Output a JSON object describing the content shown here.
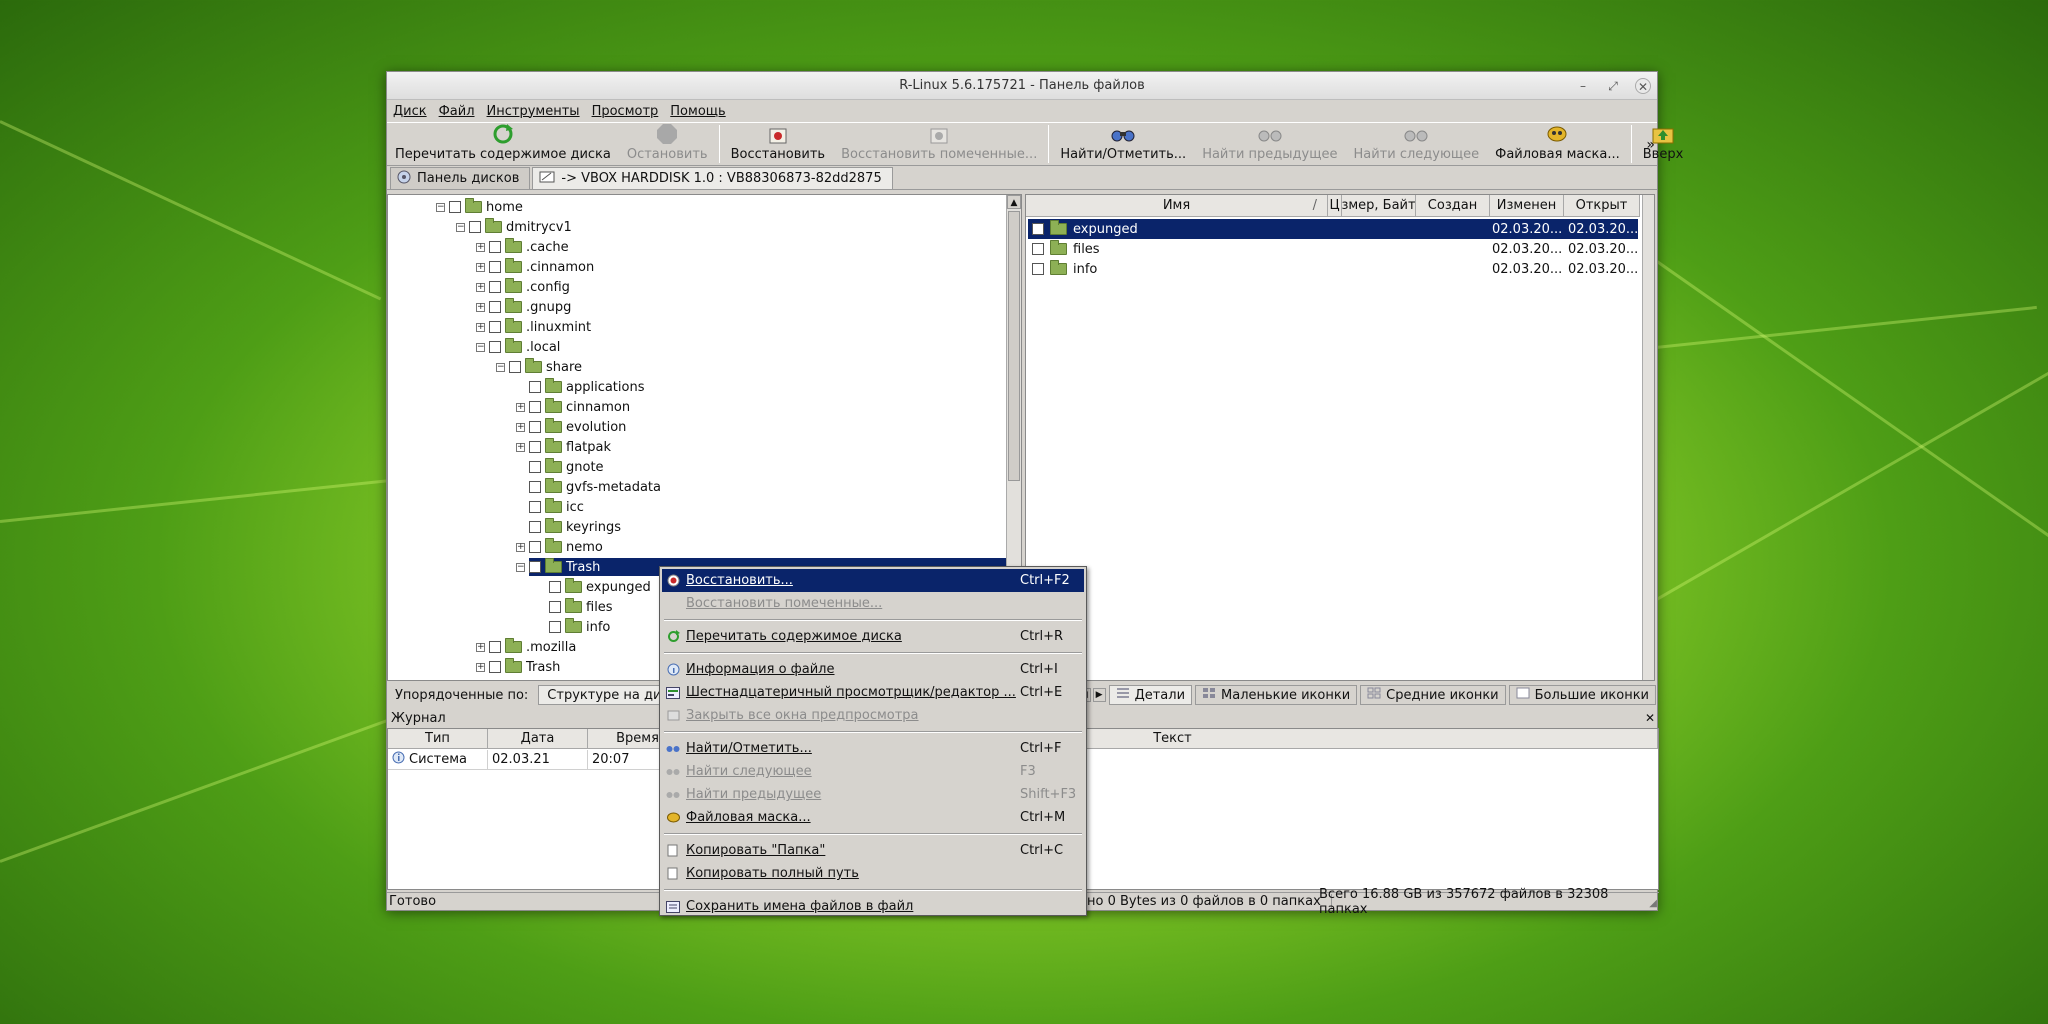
{
  "window": {
    "title": "R-Linux 5.6.175721 - Панель файлов"
  },
  "menu": [
    "Диск",
    "Файл",
    "Инструменты",
    "Просмотр",
    "Помощь"
  ],
  "toolbar": {
    "rescan": "Перечитать содержимое диска",
    "stop": "Остановить",
    "restore": "Восстановить",
    "restore_marked": "Восстановить помеченные...",
    "find": "Найти/Отметить...",
    "find_prev": "Найти предыдущее",
    "find_next": "Найти следующее",
    "file_mask": "Файловая маска...",
    "up": "Вверх",
    "more": "»"
  },
  "tabs": {
    "disks": "Панель дисков",
    "disk": "-> VBOX HARDDISK 1.0 : VB88306873-82dd2875"
  },
  "tree": [
    "home",
    "dmitrycv1",
    ".cache",
    ".cinnamon",
    ".config",
    ".gnupg",
    ".linuxmint",
    ".local",
    "share",
    "applications",
    "cinnamon",
    "evolution",
    "flatpak",
    "gnote",
    "gvfs-metadata",
    "icc",
    "keyrings",
    "nemo",
    "Trash",
    "expunged",
    "files",
    "info",
    ".mozilla",
    "Trash"
  ],
  "files": {
    "headers": {
      "name": "Имя",
      "c": "Ц",
      "size": "змер, Байт",
      "created": "Создан",
      "modified": "Изменен",
      "opened": "Открыт"
    },
    "rows": [
      {
        "name": "expunged",
        "modified": "02.03.20...",
        "opened": "02.03.20..."
      },
      {
        "name": "files",
        "modified": "02.03.20...",
        "opened": "02.03.20..."
      },
      {
        "name": "info",
        "modified": "02.03.20...",
        "opened": "02.03.20..."
      }
    ]
  },
  "sortbar": {
    "label": "Упорядоченные по:",
    "value": "Структуре на диск",
    "views": {
      "details": "Детали",
      "small": "Маленькие иконки",
      "medium": "Средние иконки",
      "large": "Большие иконки"
    }
  },
  "journal": {
    "title": "Журнал",
    "cols": {
      "type": "Тип",
      "date": "Дата",
      "time": "Время",
      "text": "Текст"
    },
    "row": {
      "type": "Система",
      "date": "02.03.21",
      "time": "20:07"
    }
  },
  "status": {
    "ready": "Готово",
    "marked": "но 0 Bytes из 0 файлов в 0 папках",
    "total": "Всего 16.88 GB из 357672 файлов в 32308 папках"
  },
  "context_menu": [
    {
      "label": "Восстановить...",
      "shortcut": "Ctrl+F2"
    },
    {
      "label": "Восстановить помеченные...",
      "shortcut": ""
    },
    {
      "label": "Перечитать содержимое диска",
      "shortcut": "Ctrl+R"
    },
    {
      "label": "Информация о файле",
      "shortcut": "Ctrl+I"
    },
    {
      "label": "Шестнадцатеричный просмотрщик/редактор ...",
      "shortcut": "Ctrl+E"
    },
    {
      "label": "Закрыть все окна предпросмотра",
      "shortcut": ""
    },
    {
      "label": "Найти/Отметить...",
      "shortcut": "Ctrl+F"
    },
    {
      "label": "Найти следующее",
      "shortcut": "F3"
    },
    {
      "label": "Найти предыдущее",
      "shortcut": "Shift+F3"
    },
    {
      "label": "Файловая маска...",
      "shortcut": "Ctrl+M"
    },
    {
      "label": "Копировать \"Папка\"",
      "shortcut": "Ctrl+C"
    },
    {
      "label": "Копировать полный путь",
      "shortcut": ""
    },
    {
      "label": "Сохранить имена файлов в файл",
      "shortcut": ""
    }
  ],
  "colors": {
    "selection": "#0a246a",
    "window_bg": "#d6d3ce",
    "folder": "#8db055"
  }
}
